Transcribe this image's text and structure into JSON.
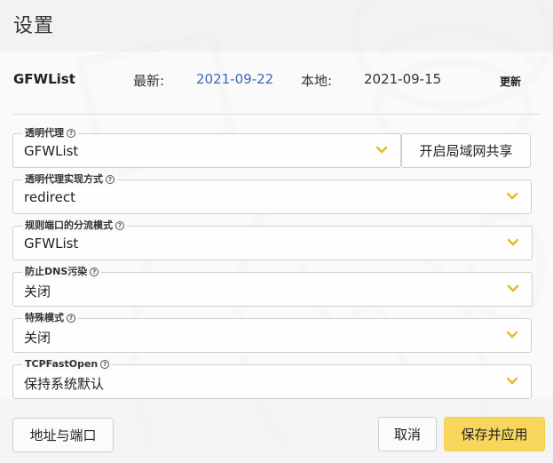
{
  "header": {
    "title": "设置"
  },
  "gfwlist": {
    "name": "GFWList",
    "latest_label": "最新:",
    "latest_value": "2021-09-22",
    "local_label": "本地:",
    "local_value": "2021-09-15",
    "update_label": "更新"
  },
  "fields": [
    {
      "label": "透明代理",
      "value": "GFWList",
      "icon": "help-circle-icon",
      "chevron": "chevron-down-icon"
    },
    {
      "label": "透明代理实现方式",
      "value": "redirect",
      "icon": "help-circle-icon",
      "chevron": "chevron-down-icon"
    },
    {
      "label": "规则端口的分流模式",
      "value": "GFWList",
      "icon": "help-circle-icon",
      "chevron": "chevron-down-icon"
    },
    {
      "label": "防止DNS污染",
      "value": "关闭",
      "icon": "help-circle-icon",
      "chevron": "chevron-down-icon"
    },
    {
      "label": "特殊模式",
      "value": "关闭",
      "icon": "help-circle-icon",
      "chevron": "chevron-down-icon"
    },
    {
      "label": "TCPFastOpen",
      "value": "保持系统默认",
      "icon": "help-circle-icon",
      "chevron": "chevron-down-icon"
    }
  ],
  "share_button_label": "开启局域网共享",
  "footer": {
    "address_port_label": "地址与端口",
    "cancel_label": "取消",
    "save_apply_label": "保存并应用"
  },
  "colors": {
    "accent": "#f8d65c",
    "chevron": "#e8b923",
    "link": "#3a6ab4"
  }
}
